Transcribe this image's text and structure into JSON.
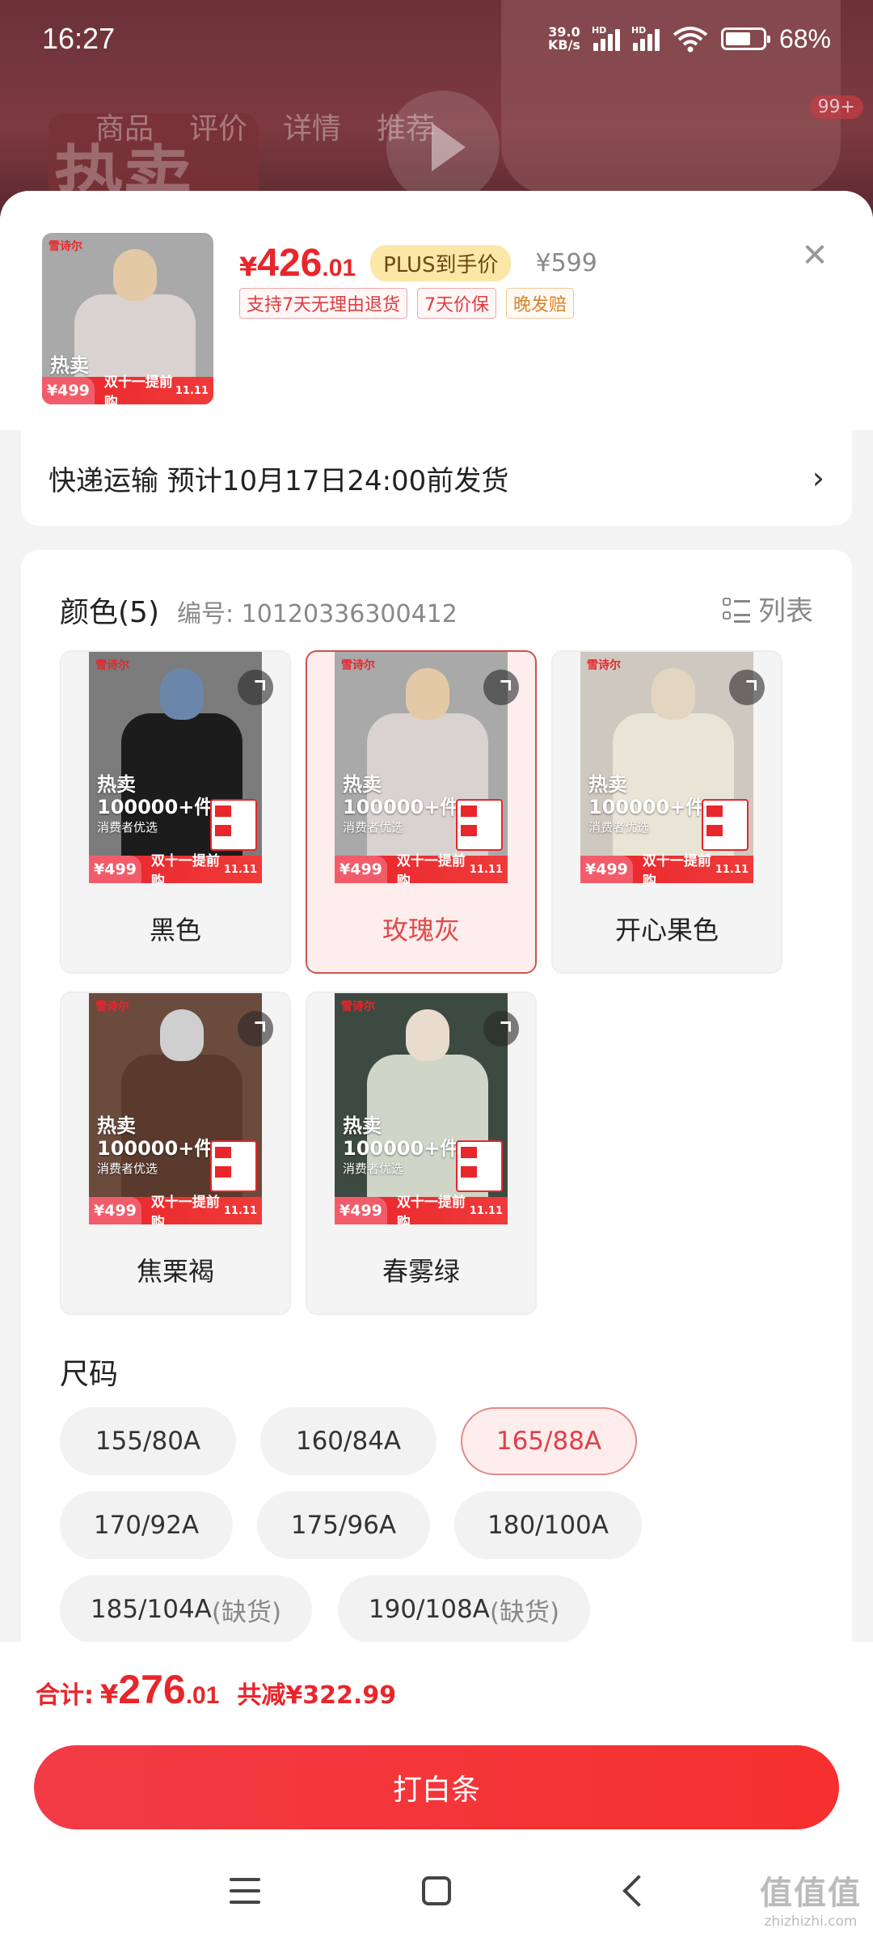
{
  "status_bar": {
    "time": "16:27",
    "net_speed_value": "39.0",
    "net_speed_unit": "KB/s",
    "signal_label": "HD",
    "battery_text": "68%",
    "battery_level": 0.68
  },
  "background_page": {
    "tabs": [
      "商品",
      "评价",
      "详情",
      "推荐"
    ],
    "big_text": "热卖",
    "badge": "99+"
  },
  "product": {
    "price_currency": "¥",
    "price_int": "426",
    "price_dec": ".01",
    "plus_badge": "PLUS到手价",
    "original_price": "¥599",
    "tags": [
      "支持7天无理由退货",
      "7天价保",
      "晚发赔"
    ]
  },
  "shipping": {
    "text": "快递运输  预计10月17日24:00前发货"
  },
  "color_section": {
    "title": "颜色(5)",
    "sku": "编号: 10120336300412",
    "list_label": "列表",
    "options": [
      {
        "label": "黑色",
        "selected": false
      },
      {
        "label": "玫瑰灰",
        "selected": true
      },
      {
        "label": "开心果色",
        "selected": false
      },
      {
        "label": "焦栗褐",
        "selected": false
      },
      {
        "label": "春雾绿",
        "selected": false
      }
    ]
  },
  "photo_text": {
    "brand": "雪诗尔",
    "hot": "热卖",
    "count": "100000+件",
    "sub": "消费者优选",
    "price": "¥499",
    "banner": "双十一提前购",
    "badge": "11.11"
  },
  "size_section": {
    "title": "尺码",
    "options": [
      {
        "label": "155/80A",
        "note": "",
        "selected": false
      },
      {
        "label": "160/84A",
        "note": "",
        "selected": false
      },
      {
        "label": "165/88A",
        "note": "",
        "selected": true
      },
      {
        "label": "170/92A",
        "note": "",
        "selected": false
      },
      {
        "label": "175/96A",
        "note": "",
        "selected": false
      },
      {
        "label": "180/100A",
        "note": "",
        "selected": false
      },
      {
        "label": "185/104A",
        "note": "(缺货)",
        "selected": false
      },
      {
        "label": "190/108A",
        "note": "(缺货)",
        "selected": false
      }
    ]
  },
  "footer": {
    "total_label": "合计:",
    "total_currency": "¥",
    "total_int": "276",
    "total_dec": ".01",
    "discount": "共减¥322.99",
    "pay_button": "打白条"
  },
  "watermark": {
    "big": "值值值",
    "small": "zhizhizhi.com"
  },
  "colors": {
    "accent": "#e8262b",
    "selected_bg": "#fdeeed",
    "plus_bg": "#fbe7a8"
  }
}
